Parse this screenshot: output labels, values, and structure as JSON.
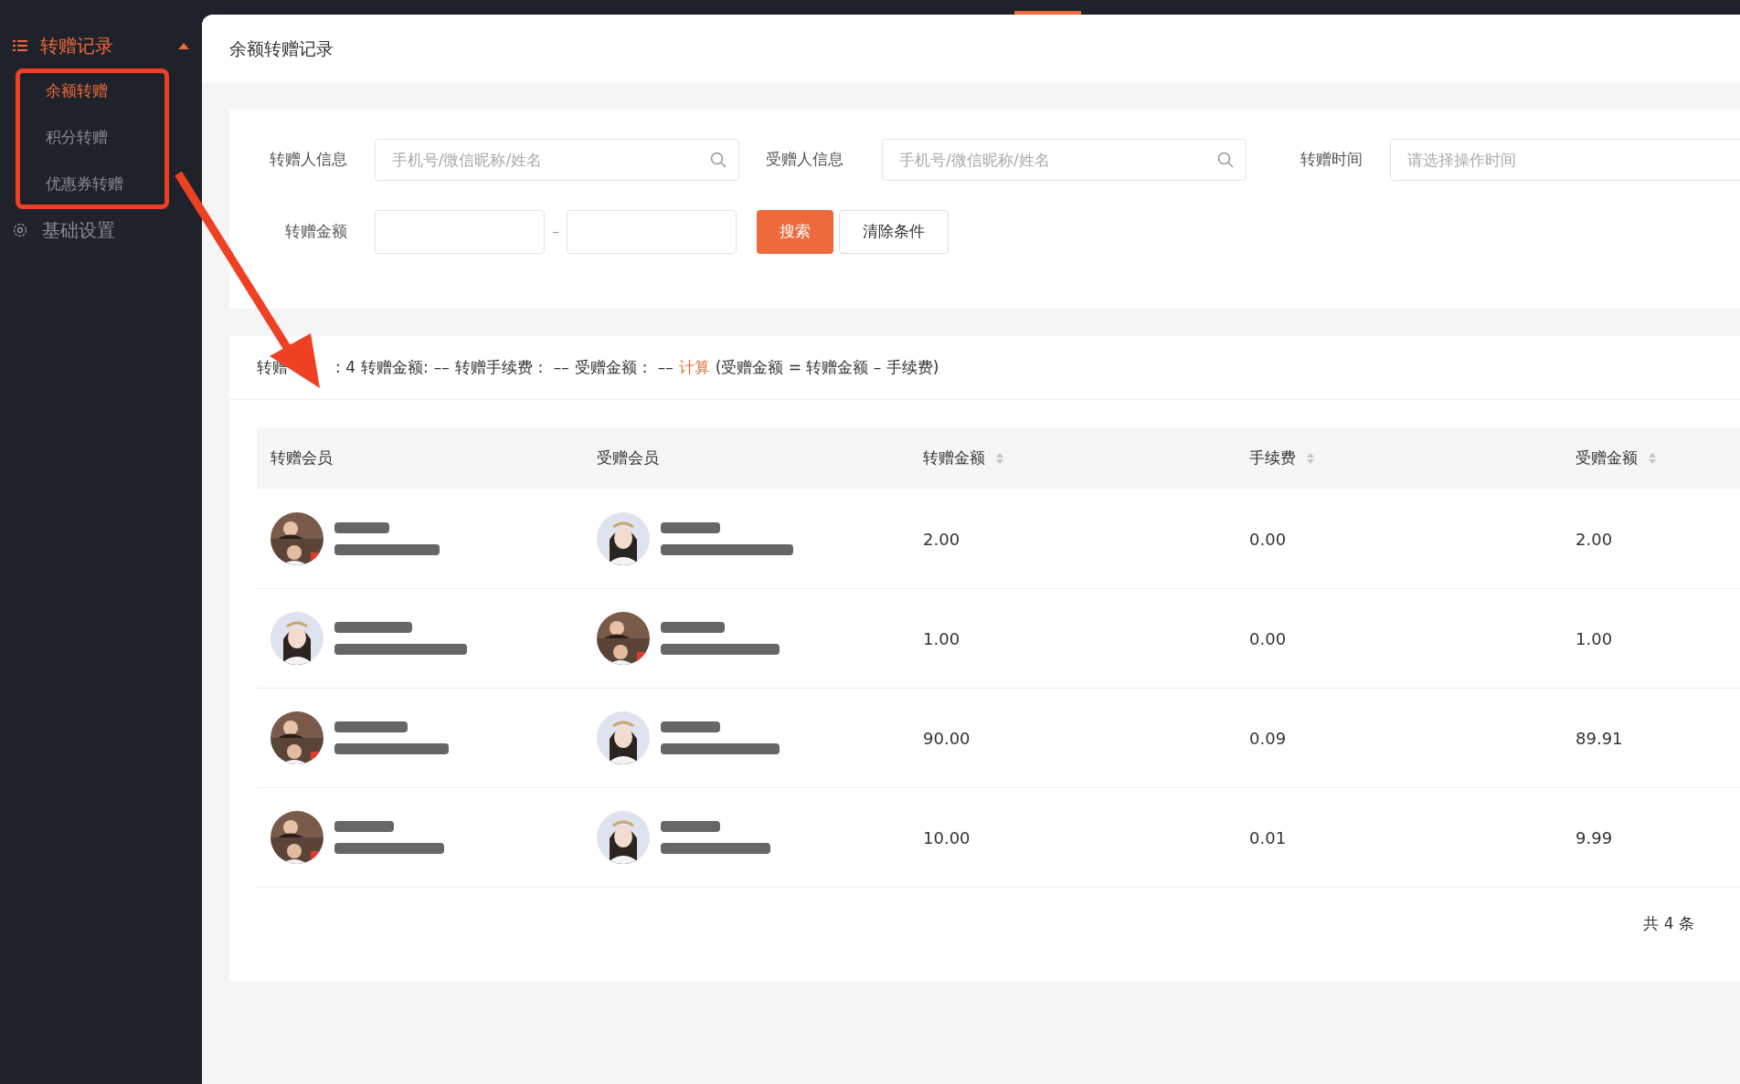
{
  "sidebar": {
    "group": {
      "label": "转赠记录",
      "expanded": true,
      "children": [
        {
          "label": "余额转赠",
          "selected": true
        },
        {
          "label": "积分转赠",
          "selected": false
        },
        {
          "label": "优惠券转赠",
          "selected": false
        }
      ]
    },
    "items": [
      {
        "label": "基础设置"
      }
    ]
  },
  "page_title": "余额转赠记录",
  "filters": {
    "giver": {
      "label": "转赠人信息",
      "placeholder": "手机号/微信昵称/姓名"
    },
    "receiver": {
      "label": "受赠人信息",
      "placeholder": "手机号/微信昵称/姓名"
    },
    "time": {
      "label": "转赠时间",
      "placeholder": "请选择操作时间"
    },
    "amount": {
      "label": "转赠金额",
      "separator": "–"
    },
    "buttons": [
      {
        "label": "搜索",
        "kind": "primary"
      },
      {
        "label": "清除条件",
        "kind": "default"
      }
    ]
  },
  "summary": {
    "count_label": "转赠",
    "count": ": 4",
    "amount_label": "转赠金额:",
    "amount": "––",
    "fee_label": "转赠手续费：",
    "fee": "––",
    "received_label": "受赠金额：",
    "received": "––",
    "link": "计算",
    "formula": "(受赠金额 = 转赠金额 – 手续费)"
  },
  "table": {
    "columns": [
      {
        "label": "转赠会员",
        "sortable": false
      },
      {
        "label": "受赠会员",
        "sortable": false
      },
      {
        "label": "转赠金额",
        "sortable": true
      },
      {
        "label": "手续费",
        "sortable": true
      },
      {
        "label": "受赠金额",
        "sortable": true
      }
    ],
    "rows": [
      {
        "from_redacted": true,
        "to_redacted": true,
        "amount": "2.00",
        "fee": "0.00",
        "received": "2.00"
      },
      {
        "from_redacted": true,
        "to_redacted": true,
        "amount": "1.00",
        "fee": "0.00",
        "received": "1.00"
      },
      {
        "from_redacted": true,
        "to_redacted": true,
        "amount": "90.00",
        "fee": "0.09",
        "received": "89.91"
      },
      {
        "from_redacted": true,
        "to_redacted": true,
        "amount": "10.00",
        "fee": "0.01",
        "received": "9.99"
      }
    ]
  },
  "pagination": {
    "total": "共 4 条"
  }
}
